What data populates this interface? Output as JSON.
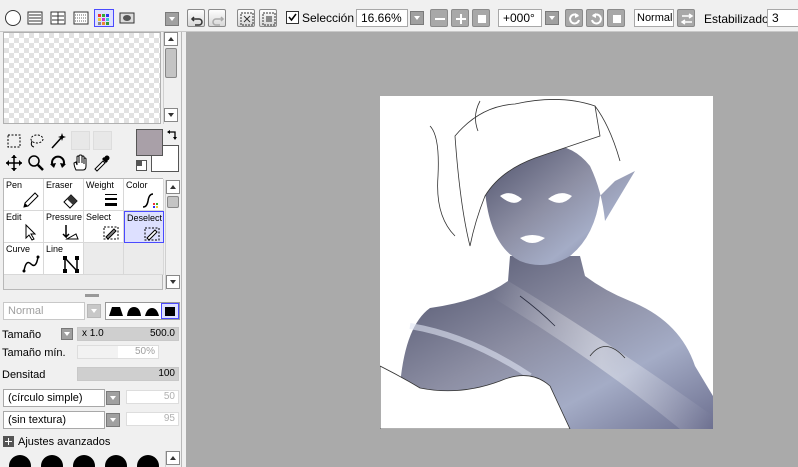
{
  "toolbar": {
    "selection_label": "Selección",
    "selection_checked": true,
    "zoom_value": "16.66%",
    "rotation_value": "+000°",
    "blend_mode": "Normal",
    "stabilizer_label": "Estabilizador",
    "stabilizer_value": "3"
  },
  "tools": {
    "primary_color": "#a9a0a8",
    "secondary_color": "#ffffff"
  },
  "brushes": [
    {
      "label": "Pen",
      "icon": "pen-icon"
    },
    {
      "label": "Eraser",
      "icon": "eraser-icon"
    },
    {
      "label": "Weight",
      "icon": "weight-icon"
    },
    {
      "label": "Color",
      "icon": "color-icon"
    },
    {
      "label": "Edit",
      "icon": "edit-icon"
    },
    {
      "label": "Pressure",
      "icon": "pressure-icon"
    },
    {
      "label": "Select",
      "icon": "select-icon"
    },
    {
      "label": "Deselect",
      "icon": "deselect-icon",
      "selected": true
    },
    {
      "label": "Curve",
      "icon": "curve-icon"
    },
    {
      "label": "Line",
      "icon": "line-icon"
    }
  ],
  "brush_settings": {
    "blend_mode": "Normal",
    "size_label": "Tamaño",
    "size_multiplier": "x 1.0",
    "size_value": "500.0",
    "min_size_label": "Tamaño mín.",
    "min_size_value": "50%",
    "density_label": "Densitad",
    "density_value": "100",
    "shape_value": "(círculo simple)",
    "shape_amount": "50",
    "texture_value": "(sin textura)",
    "texture_amount": "95",
    "advanced_label": "Ajustes avanzados"
  }
}
